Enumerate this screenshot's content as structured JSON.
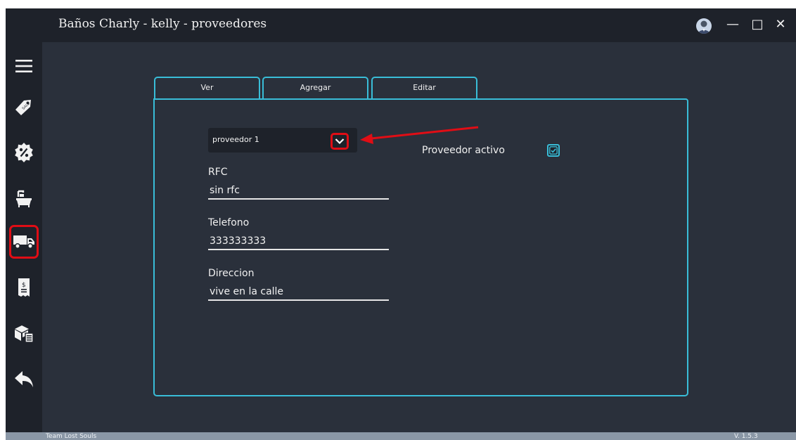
{
  "window": {
    "title": "Baños Charly - kelly - proveedores",
    "controls": {
      "minimize": "—",
      "maximize": "□",
      "close": "✕"
    }
  },
  "sidebar": {
    "items": [
      {
        "icon": "menu-icon"
      },
      {
        "icon": "sale-tag-icon"
      },
      {
        "icon": "discount-badge-icon"
      },
      {
        "icon": "bathtub-icon"
      },
      {
        "icon": "truck-icon",
        "selected": true
      },
      {
        "icon": "receipt-icon"
      },
      {
        "icon": "inventory-boxes-icon"
      },
      {
        "icon": "back-arrow-icon"
      }
    ]
  },
  "tabs": [
    {
      "label": "Ver"
    },
    {
      "label": "Agregar"
    },
    {
      "label": "Editar"
    }
  ],
  "form": {
    "selected_provider": "proveedor 1",
    "fields": [
      {
        "label": "RFC",
        "value": "sin rfc"
      },
      {
        "label": "Telefono",
        "value": "333333333"
      },
      {
        "label": "Direccion",
        "value": "vive en la calle"
      }
    ],
    "active_label": "Proveedor activo",
    "active_checked": true
  },
  "status": {
    "team": "Team Lost Souls",
    "version": "V. 1.5.3"
  },
  "colors": {
    "accent": "#39bdd8",
    "highlight": "#e00d15",
    "background": "#2a303b",
    "sidebar": "#1e222a"
  }
}
